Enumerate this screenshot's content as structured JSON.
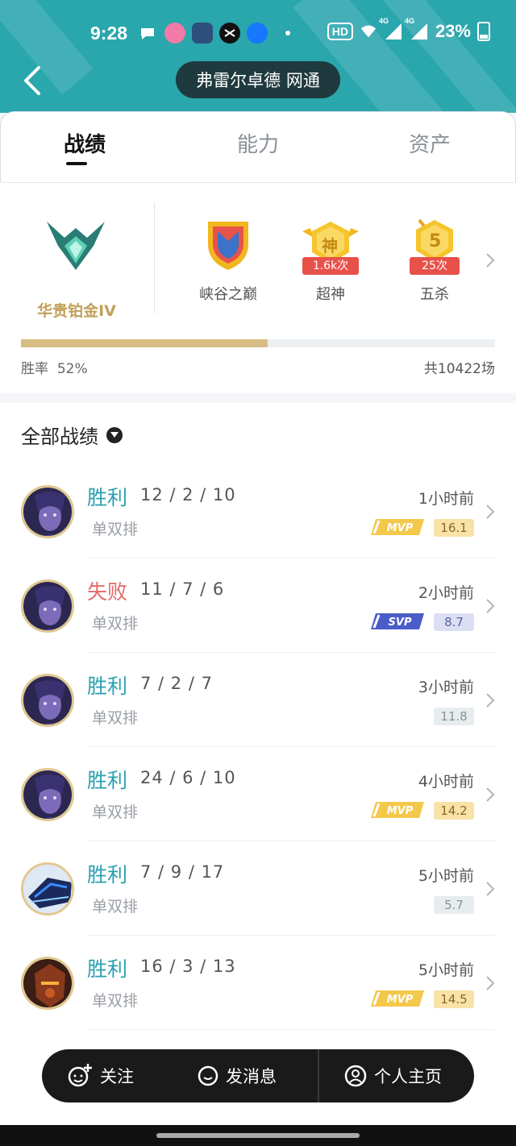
{
  "status_bar": {
    "time": "9:28",
    "hd_label": "HD",
    "network_1": "4G",
    "network_2": "4G",
    "battery": "23%"
  },
  "header": {
    "title": "弗雷尔卓德 网通"
  },
  "tabs": [
    {
      "label": "战绩",
      "active": true
    },
    {
      "label": "能力",
      "active": false
    },
    {
      "label": "资产",
      "active": false
    }
  ],
  "summary": {
    "rank": "华贵铂金IV",
    "honors": [
      {
        "name": "峡谷之巅",
        "count": ""
      },
      {
        "name": "超神",
        "count": "1.6k次",
        "emblem_char": "神"
      },
      {
        "name": "五杀",
        "count": "25次",
        "emblem_char": "5"
      }
    ],
    "win_rate_label": "胜率",
    "win_rate_value": "52%",
    "win_rate_fraction": 0.52,
    "total_games": "共10422场"
  },
  "matches": {
    "filter_label": "全部战绩",
    "rows": [
      {
        "result": "胜利",
        "win": true,
        "kda": "12 / 2 / 10",
        "queue": "单双排",
        "time": "1小时前",
        "badge": "MVP",
        "score": "16.1",
        "score_style": "gold",
        "avatar": "purple"
      },
      {
        "result": "失败",
        "win": false,
        "kda": "11 / 7 / 6",
        "queue": "单双排",
        "time": "2小时前",
        "badge": "SVP",
        "score": "8.7",
        "score_style": "blue",
        "avatar": "purple"
      },
      {
        "result": "胜利",
        "win": true,
        "kda": "7 / 2 / 7",
        "queue": "单双排",
        "time": "3小时前",
        "badge": "",
        "score": "11.8",
        "score_style": "grey",
        "avatar": "purple"
      },
      {
        "result": "胜利",
        "win": true,
        "kda": "24 / 6 / 10",
        "queue": "单双排",
        "time": "4小时前",
        "badge": "MVP",
        "score": "14.2",
        "score_style": "gold",
        "avatar": "purple"
      },
      {
        "result": "胜利",
        "win": true,
        "kda": "7 / 9 / 17",
        "queue": "单双排",
        "time": "5小时前",
        "badge": "",
        "score": "5.7",
        "score_style": "grey",
        "avatar": "blue-mech"
      },
      {
        "result": "胜利",
        "win": true,
        "kda": "16 / 3 / 13",
        "queue": "单双排",
        "time": "5小时前",
        "badge": "MVP",
        "score": "14.5",
        "score_style": "gold",
        "avatar": "orange-warrior"
      }
    ]
  },
  "action_bar": {
    "follow": "关注",
    "message": "发消息",
    "profile": "个人主页"
  },
  "colors": {
    "header_teal": "#2aa6ad",
    "win": "#2aa0b0",
    "loss": "#e26a6a",
    "rank_gold": "#c2a05a"
  }
}
